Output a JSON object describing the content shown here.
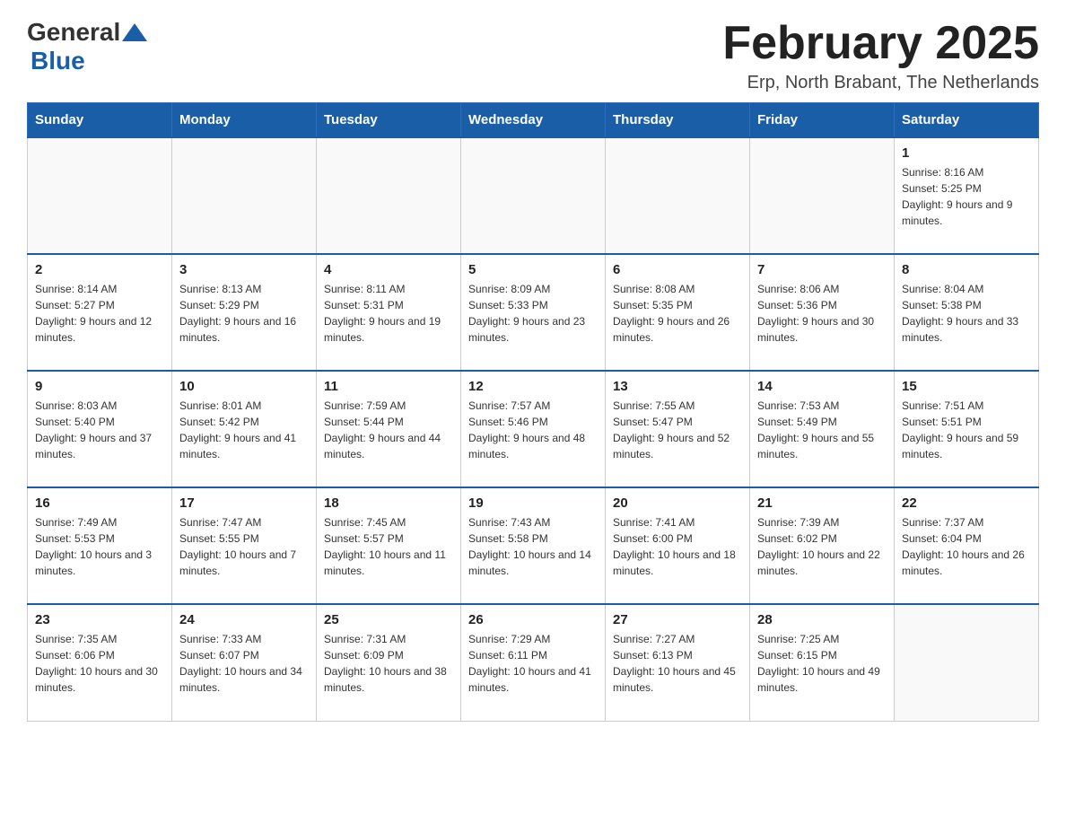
{
  "logo": {
    "general": "General",
    "blue": "Blue"
  },
  "header": {
    "title": "February 2025",
    "location": "Erp, North Brabant, The Netherlands"
  },
  "weekdays": [
    "Sunday",
    "Monday",
    "Tuesday",
    "Wednesday",
    "Thursday",
    "Friday",
    "Saturday"
  ],
  "weeks": [
    [
      {
        "day": "",
        "info": ""
      },
      {
        "day": "",
        "info": ""
      },
      {
        "day": "",
        "info": ""
      },
      {
        "day": "",
        "info": ""
      },
      {
        "day": "",
        "info": ""
      },
      {
        "day": "",
        "info": ""
      },
      {
        "day": "1",
        "info": "Sunrise: 8:16 AM\nSunset: 5:25 PM\nDaylight: 9 hours and 9 minutes."
      }
    ],
    [
      {
        "day": "2",
        "info": "Sunrise: 8:14 AM\nSunset: 5:27 PM\nDaylight: 9 hours and 12 minutes."
      },
      {
        "day": "3",
        "info": "Sunrise: 8:13 AM\nSunset: 5:29 PM\nDaylight: 9 hours and 16 minutes."
      },
      {
        "day": "4",
        "info": "Sunrise: 8:11 AM\nSunset: 5:31 PM\nDaylight: 9 hours and 19 minutes."
      },
      {
        "day": "5",
        "info": "Sunrise: 8:09 AM\nSunset: 5:33 PM\nDaylight: 9 hours and 23 minutes."
      },
      {
        "day": "6",
        "info": "Sunrise: 8:08 AM\nSunset: 5:35 PM\nDaylight: 9 hours and 26 minutes."
      },
      {
        "day": "7",
        "info": "Sunrise: 8:06 AM\nSunset: 5:36 PM\nDaylight: 9 hours and 30 minutes."
      },
      {
        "day": "8",
        "info": "Sunrise: 8:04 AM\nSunset: 5:38 PM\nDaylight: 9 hours and 33 minutes."
      }
    ],
    [
      {
        "day": "9",
        "info": "Sunrise: 8:03 AM\nSunset: 5:40 PM\nDaylight: 9 hours and 37 minutes."
      },
      {
        "day": "10",
        "info": "Sunrise: 8:01 AM\nSunset: 5:42 PM\nDaylight: 9 hours and 41 minutes."
      },
      {
        "day": "11",
        "info": "Sunrise: 7:59 AM\nSunset: 5:44 PM\nDaylight: 9 hours and 44 minutes."
      },
      {
        "day": "12",
        "info": "Sunrise: 7:57 AM\nSunset: 5:46 PM\nDaylight: 9 hours and 48 minutes."
      },
      {
        "day": "13",
        "info": "Sunrise: 7:55 AM\nSunset: 5:47 PM\nDaylight: 9 hours and 52 minutes."
      },
      {
        "day": "14",
        "info": "Sunrise: 7:53 AM\nSunset: 5:49 PM\nDaylight: 9 hours and 55 minutes."
      },
      {
        "day": "15",
        "info": "Sunrise: 7:51 AM\nSunset: 5:51 PM\nDaylight: 9 hours and 59 minutes."
      }
    ],
    [
      {
        "day": "16",
        "info": "Sunrise: 7:49 AM\nSunset: 5:53 PM\nDaylight: 10 hours and 3 minutes."
      },
      {
        "day": "17",
        "info": "Sunrise: 7:47 AM\nSunset: 5:55 PM\nDaylight: 10 hours and 7 minutes."
      },
      {
        "day": "18",
        "info": "Sunrise: 7:45 AM\nSunset: 5:57 PM\nDaylight: 10 hours and 11 minutes."
      },
      {
        "day": "19",
        "info": "Sunrise: 7:43 AM\nSunset: 5:58 PM\nDaylight: 10 hours and 14 minutes."
      },
      {
        "day": "20",
        "info": "Sunrise: 7:41 AM\nSunset: 6:00 PM\nDaylight: 10 hours and 18 minutes."
      },
      {
        "day": "21",
        "info": "Sunrise: 7:39 AM\nSunset: 6:02 PM\nDaylight: 10 hours and 22 minutes."
      },
      {
        "day": "22",
        "info": "Sunrise: 7:37 AM\nSunset: 6:04 PM\nDaylight: 10 hours and 26 minutes."
      }
    ],
    [
      {
        "day": "23",
        "info": "Sunrise: 7:35 AM\nSunset: 6:06 PM\nDaylight: 10 hours and 30 minutes."
      },
      {
        "day": "24",
        "info": "Sunrise: 7:33 AM\nSunset: 6:07 PM\nDaylight: 10 hours and 34 minutes."
      },
      {
        "day": "25",
        "info": "Sunrise: 7:31 AM\nSunset: 6:09 PM\nDaylight: 10 hours and 38 minutes."
      },
      {
        "day": "26",
        "info": "Sunrise: 7:29 AM\nSunset: 6:11 PM\nDaylight: 10 hours and 41 minutes."
      },
      {
        "day": "27",
        "info": "Sunrise: 7:27 AM\nSunset: 6:13 PM\nDaylight: 10 hours and 45 minutes."
      },
      {
        "day": "28",
        "info": "Sunrise: 7:25 AM\nSunset: 6:15 PM\nDaylight: 10 hours and 49 minutes."
      },
      {
        "day": "",
        "info": ""
      }
    ]
  ]
}
